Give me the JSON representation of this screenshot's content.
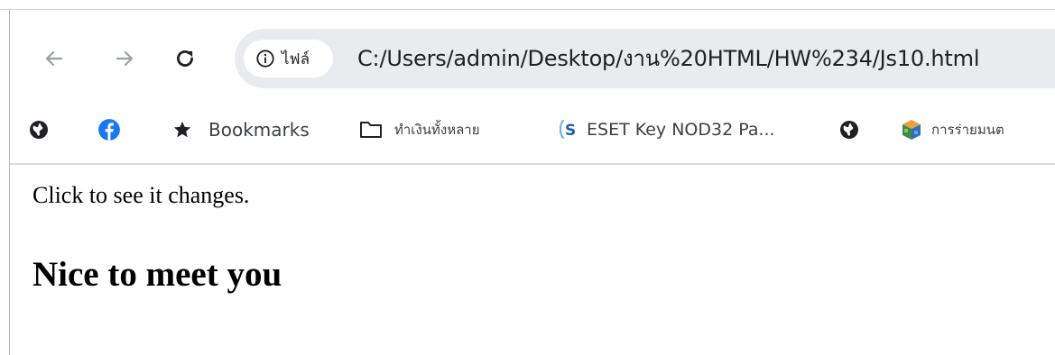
{
  "browser": {
    "nav": {
      "back_icon": "arrow-left-icon",
      "forward_icon": "arrow-right-icon",
      "reload_icon": "reload-icon"
    },
    "omnibox": {
      "chip_icon": "info-icon",
      "chip_label": "ไฟล์",
      "url": "C:/Users/admin/Desktop/งาน%20HTML/HW%234/Js10.html"
    },
    "bookmarks": [
      {
        "icon": "globe-icon",
        "label": ""
      },
      {
        "icon": "facebook-icon",
        "label": ""
      },
      {
        "icon": "star-icon",
        "label": "Bookmarks"
      },
      {
        "icon": "folder-icon",
        "label": "ทำเงินทั้งหลาย"
      },
      {
        "icon": "eset-icon",
        "label": "ESET Key NOD32 Pa..."
      },
      {
        "icon": "globe-icon",
        "label": ""
      },
      {
        "icon": "cube-icon",
        "label": "การร่ายมนต"
      }
    ]
  },
  "page": {
    "paragraph": "Click to see it changes.",
    "heading": "Nice to meet you"
  },
  "colors": {
    "omnibox_bg": "#e9ebee",
    "facebook_blue": "#1877f2",
    "eset_blue": "#1f5eb0",
    "text_dark": "#202124"
  }
}
